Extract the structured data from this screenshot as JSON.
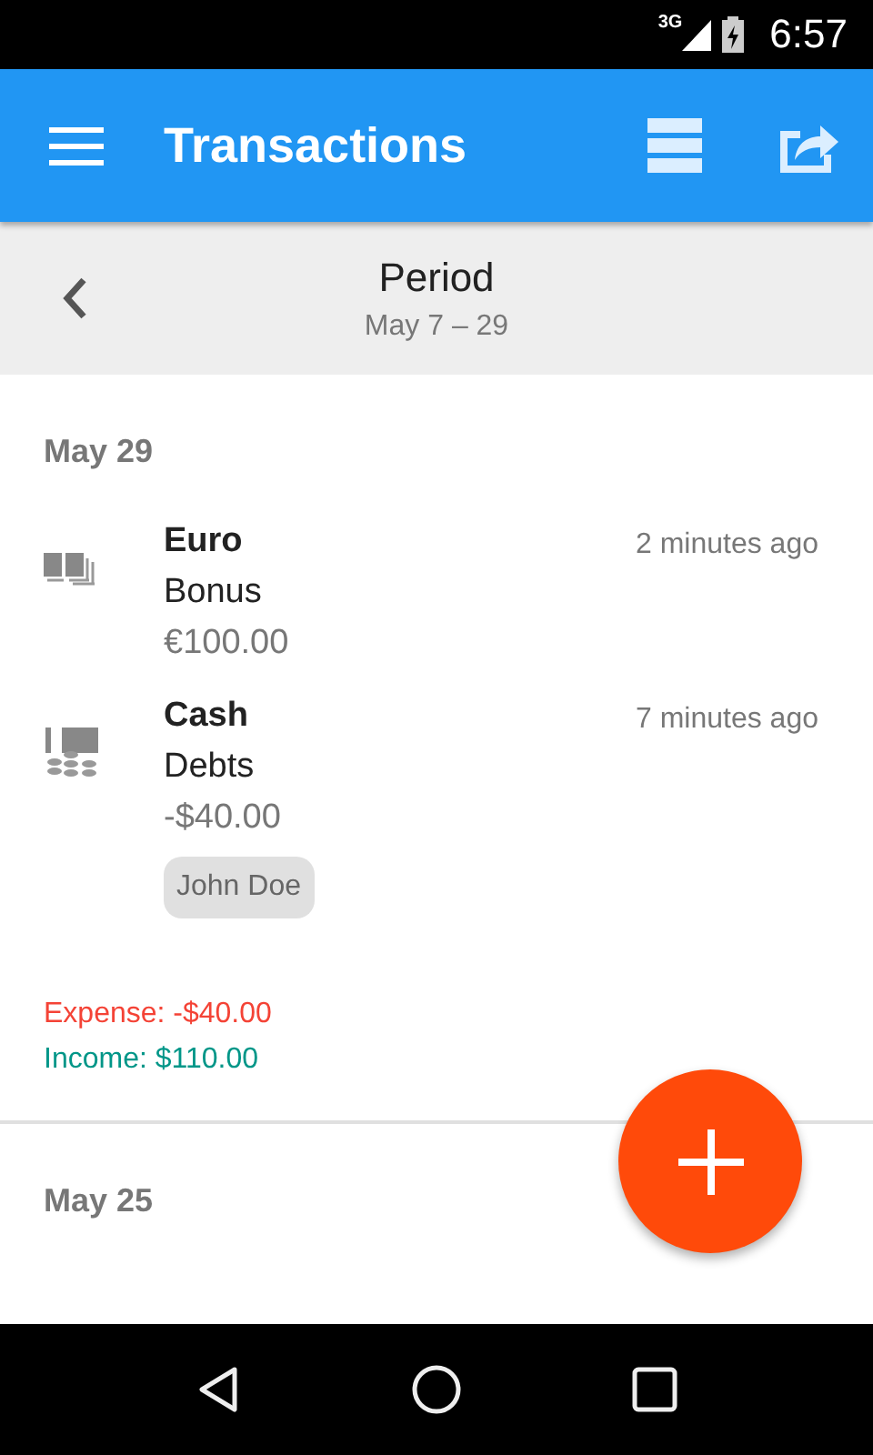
{
  "status_bar": {
    "network": "3G",
    "time": "6:57"
  },
  "app_bar": {
    "title": "Transactions"
  },
  "period": {
    "title": "Period",
    "range": "May 7 – 29"
  },
  "days": [
    {
      "date": "May 29",
      "transactions": [
        {
          "kind": "euro",
          "account": "Euro",
          "category": "Bonus",
          "amount": "€100.00",
          "time": "2 minutes ago"
        },
        {
          "kind": "cash",
          "account": "Cash",
          "category": "Debts",
          "amount": "-$40.00",
          "time": "7 minutes ago",
          "tags": [
            "John Doe"
          ]
        }
      ],
      "totals": [
        {
          "kind": "expense",
          "text": "Expense: -$40.00"
        },
        {
          "kind": "income",
          "text": "Income: $110.00"
        }
      ]
    },
    {
      "date": "May 25"
    }
  ]
}
